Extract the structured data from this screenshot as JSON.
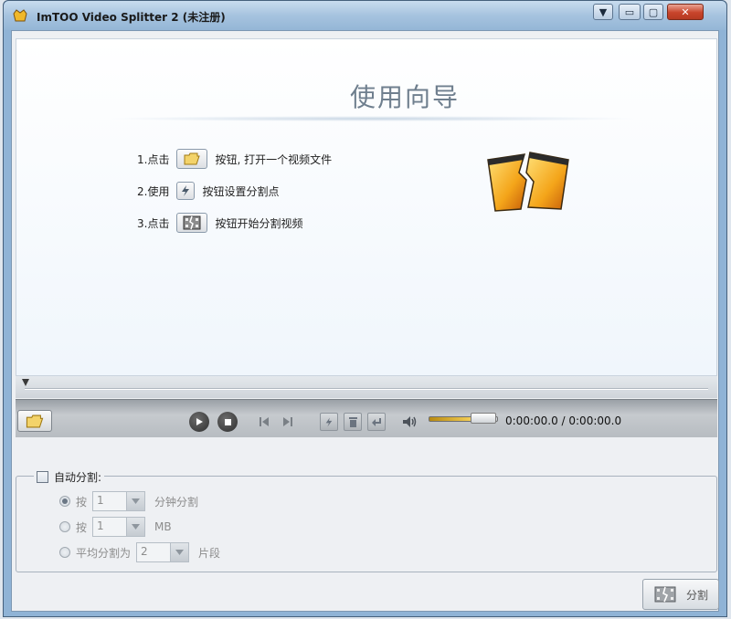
{
  "window": {
    "title": "ImTOO Video Splitter 2 (未注册)",
    "buttons": {
      "dropdown": "▼",
      "minimize": "▭",
      "maximize": "▢",
      "close": "✕"
    }
  },
  "wizard": {
    "title": "使用向导",
    "steps": [
      {
        "prefix": "1.点击",
        "text": "按钮, 打开一个视频文件",
        "icon": "folder-icon"
      },
      {
        "prefix": "2.使用",
        "text": "按钮设置分割点",
        "icon": "split-point-icon"
      },
      {
        "prefix": "3.点击",
        "text": "按钮开始分割视频",
        "icon": "film-split-icon"
      }
    ]
  },
  "player": {
    "time": "0:00:00.0 / 0:00:00.0",
    "volume_level": 0.62
  },
  "auto_split": {
    "label": "自动分割:",
    "checked": false,
    "options": [
      {
        "prefix": "按",
        "value": "1",
        "suffix": "分钟分割",
        "selected": true
      },
      {
        "prefix": "按",
        "value": "1",
        "suffix": "MB",
        "selected": false
      },
      {
        "prefix": "平均分割为",
        "value": "2",
        "suffix": "片段",
        "selected": false
      }
    ]
  },
  "split_button": {
    "label": "分割"
  },
  "colors": {
    "accent_gold": "#f2cc54",
    "title_bar": "#a6c3df",
    "close_red": "#c8442b"
  }
}
